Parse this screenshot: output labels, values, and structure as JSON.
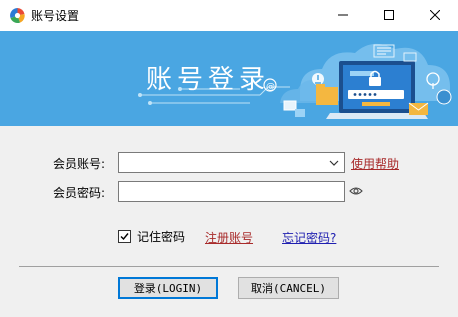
{
  "window": {
    "title": "账号设置",
    "icon": "app-logo-icon",
    "controls": [
      "minimize-icon",
      "maximize-icon",
      "close-icon"
    ]
  },
  "banner": {
    "title": "账号登录",
    "background_color": "#4aa6e2",
    "illustration": "login-laptop-cloud-illustration"
  },
  "form": {
    "account_label": "会员账号:",
    "account_value": "",
    "password_label": "会员密码:",
    "password_value": "",
    "help_link": "使用帮助",
    "show_password_icon": "eye-icon"
  },
  "options": {
    "remember_label": "记住密码",
    "remember_checked": true,
    "register_link": "注册账号",
    "forgot_link": "忘记密码?"
  },
  "buttons": {
    "login": "登录(LOGIN)",
    "cancel": "取消(CANCEL)"
  },
  "colors": {
    "link_red": "#a82a2a",
    "link_blue": "#1f1fb0",
    "focus_blue": "#0078d7"
  }
}
